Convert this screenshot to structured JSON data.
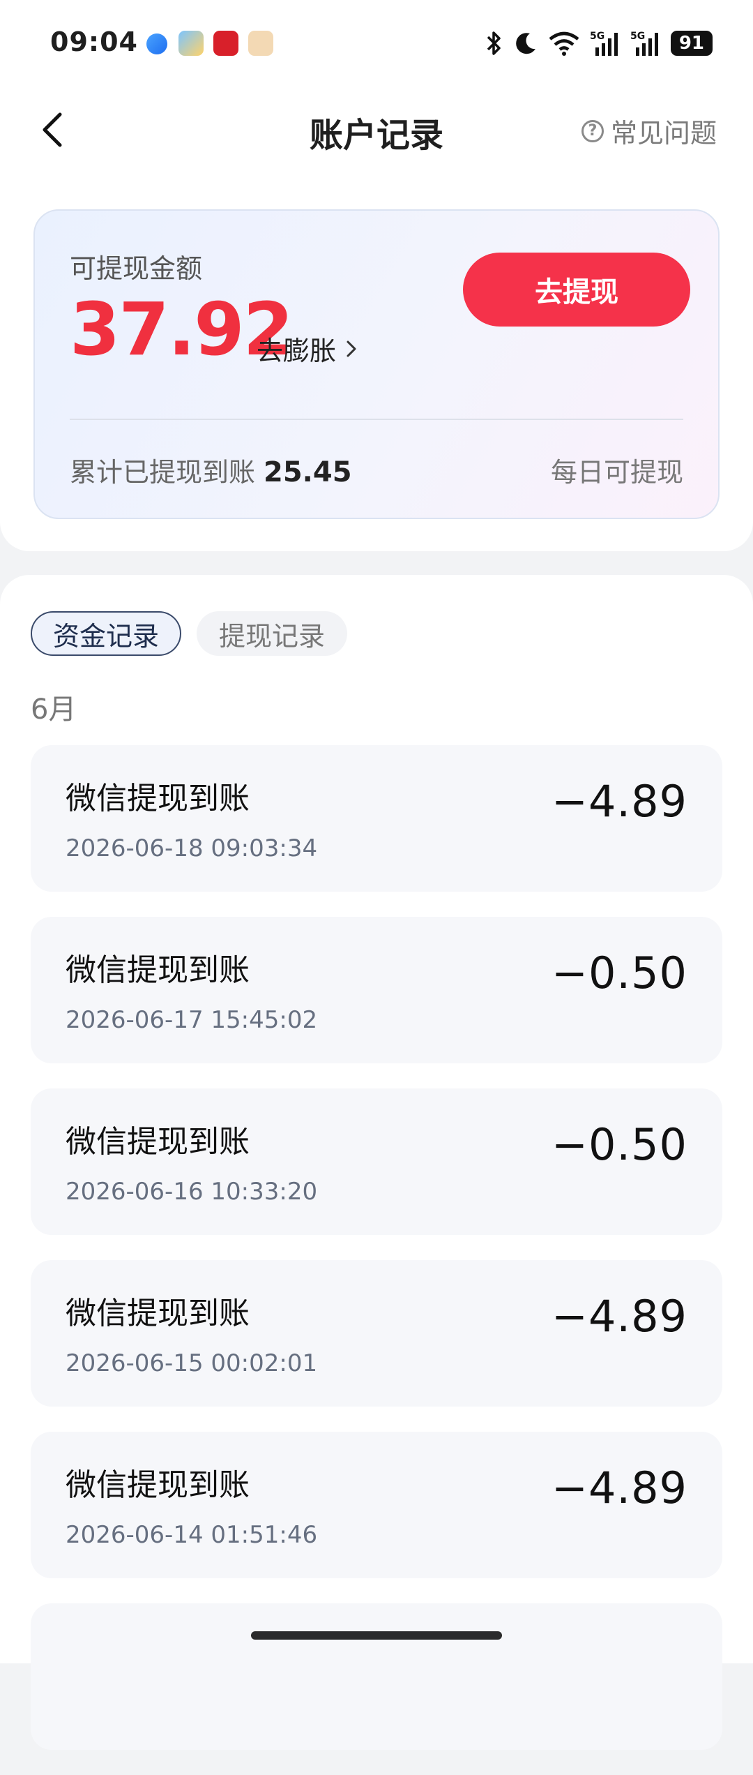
{
  "status_bar": {
    "time": "09:04",
    "network": "5G",
    "battery": "91"
  },
  "nav": {
    "title": "账户记录",
    "faq": "常见问题"
  },
  "balance": {
    "label": "可提现金额",
    "amount": "37.92",
    "expand_link": "去膨胀",
    "withdraw_button": "去提现",
    "total_label": "累计已提现到账",
    "total_value": "25.45",
    "daily_note": "每日可提现",
    "accent_color": "#f0303f"
  },
  "tabs": [
    {
      "label": "资金记录",
      "active": true
    },
    {
      "label": "提现记录",
      "active": false
    }
  ],
  "month": "6月",
  "records": [
    {
      "title": "微信提现到账",
      "time": "2026-06-18 09:03:34",
      "amount": "−4.89"
    },
    {
      "title": "微信提现到账",
      "time": "2026-06-17 15:45:02",
      "amount": "−0.50"
    },
    {
      "title": "微信提现到账",
      "time": "2026-06-16 10:33:20",
      "amount": "−0.50"
    },
    {
      "title": "微信提现到账",
      "time": "2026-06-15 00:02:01",
      "amount": "−4.89"
    },
    {
      "title": "微信提现到账",
      "time": "2026-06-14 01:51:46",
      "amount": "−4.89"
    }
  ]
}
